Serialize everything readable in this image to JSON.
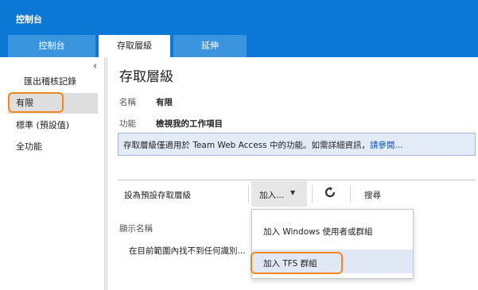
{
  "header": {
    "title": "控制台",
    "tabs": [
      {
        "label": "控制台"
      },
      {
        "label": "存取層級"
      },
      {
        "label": "延伸"
      }
    ]
  },
  "sidebar": {
    "collapse_glyph": "‹",
    "export_link": "匯出稽核記錄",
    "items": [
      {
        "label": "有限"
      },
      {
        "label": "標準 (預設值)"
      },
      {
        "label": "全功能"
      }
    ]
  },
  "main": {
    "title": "存取層級",
    "name_label": "名稱",
    "name_value": "有限",
    "func_label": "功能",
    "func_value": "檢視我的工作項目",
    "info_text": "存取層級僅適用於 Team Web Access 中的功能。如需詳細資訊，",
    "info_link": "請參閱..."
  },
  "toolbar": {
    "set_default": "設為預設存取層級",
    "add": "加入...",
    "add_caret": "▼",
    "search": "搜尋"
  },
  "table": {
    "column_header": "顯示名稱",
    "empty_message": "在目前範圍內找不到任何識別..."
  },
  "dropdown": {
    "items": [
      {
        "label": "加入 Windows 使用者或群組"
      },
      {
        "label": "加入 TFS 群組"
      }
    ]
  },
  "colors": {
    "header_blue": "#0a78d4",
    "highlight_orange": "#f0881e",
    "info_bg": "#e2ebf6"
  }
}
